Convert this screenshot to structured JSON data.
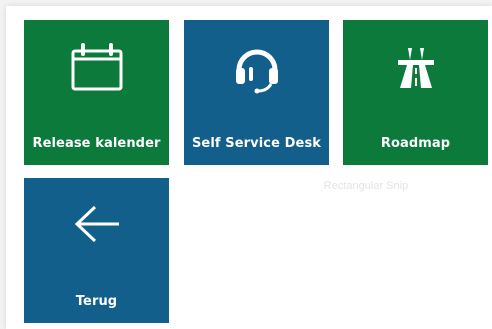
{
  "colors": {
    "green_tile": "#0b7a3b",
    "blue_tile": "#125f8c",
    "icon_white": "#ffffff"
  },
  "tiles": [
    {
      "id": "release",
      "label": "Release kalender",
      "icon": "calendar-icon",
      "color": "#0b7a3b"
    },
    {
      "id": "desk",
      "label": "Self Service Desk",
      "icon": "headset-icon",
      "color": "#125f8c"
    },
    {
      "id": "roadmap",
      "label": "Roadmap",
      "icon": "highway-road-icon",
      "color": "#0b7a3b"
    },
    {
      "id": "terug",
      "label": "Terug",
      "icon": "arrow-left-icon",
      "color": "#125f8c"
    }
  ],
  "ghost_tooltip": {
    "text": "Rectangular Snip"
  }
}
